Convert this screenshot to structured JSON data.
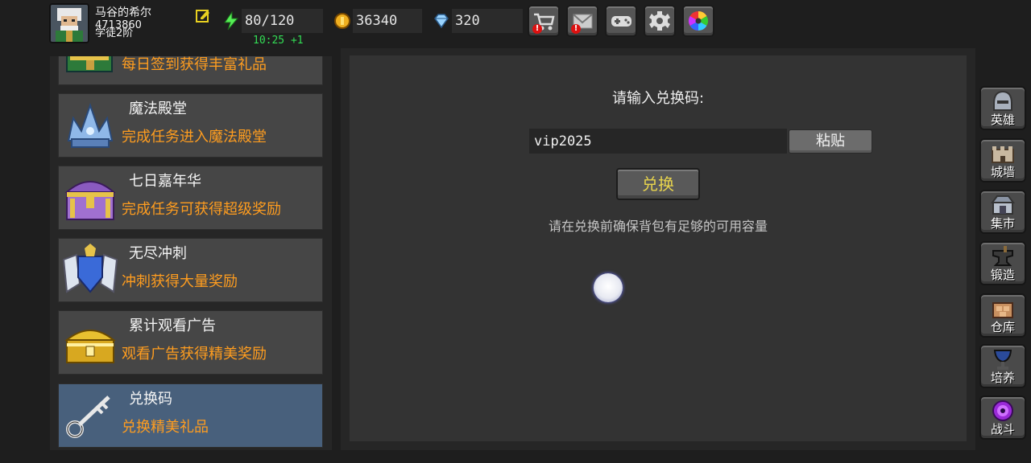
{
  "player": {
    "name": "马谷的希尔",
    "id": "4713860",
    "rank": "学徒2阶"
  },
  "resources": {
    "energy": "80/120",
    "energy_timer": "10:25 +1",
    "gold": "36340",
    "gems": "320"
  },
  "top_buttons": [
    "shop-cart-icon",
    "mail-icon",
    "gamepad-icon",
    "settings-gear-icon",
    "color-wheel-icon"
  ],
  "events": [
    {
      "title": "",
      "desc": "每日签到获得丰富礼品",
      "icon": "green-book-icon"
    },
    {
      "title": "魔法殿堂",
      "desc": "完成任务进入魔法殿堂",
      "icon": "crystal-crown-icon"
    },
    {
      "title": "七日嘉年华",
      "desc": "完成任务可获得超级奖励",
      "icon": "purple-chest-icon"
    },
    {
      "title": "无尽冲刺",
      "desc": "冲刺获得大量奖励",
      "icon": "winged-shield-icon"
    },
    {
      "title": "累计观看广告",
      "desc": "观看广告获得精美奖励",
      "icon": "gold-chest-icon"
    },
    {
      "title": "兑换码",
      "desc": "兑换精美礼品",
      "icon": "key-icon"
    }
  ],
  "redeem": {
    "prompt": "请输入兑换码:",
    "code_value": "vip2025",
    "paste_label": "粘贴",
    "redeem_label": "兑换",
    "note": "请在兑换前确保背包有足够的可用容量"
  },
  "right_nav": [
    {
      "label": "英雄",
      "icon": "helmet-icon"
    },
    {
      "label": "城墙",
      "icon": "wall-icon"
    },
    {
      "label": "集市",
      "icon": "market-icon"
    },
    {
      "label": "锻造",
      "icon": "anvil-icon"
    },
    {
      "label": "仓库",
      "icon": "warehouse-icon"
    },
    {
      "label": "培养",
      "icon": "chalice-icon"
    },
    {
      "label": "战斗",
      "icon": "portal-icon"
    }
  ],
  "colors": {
    "accent_orange": "#ff9d1f",
    "selected_card": "#48607c",
    "redeem_text": "#e8d44d",
    "timer_green": "#33dd55"
  }
}
